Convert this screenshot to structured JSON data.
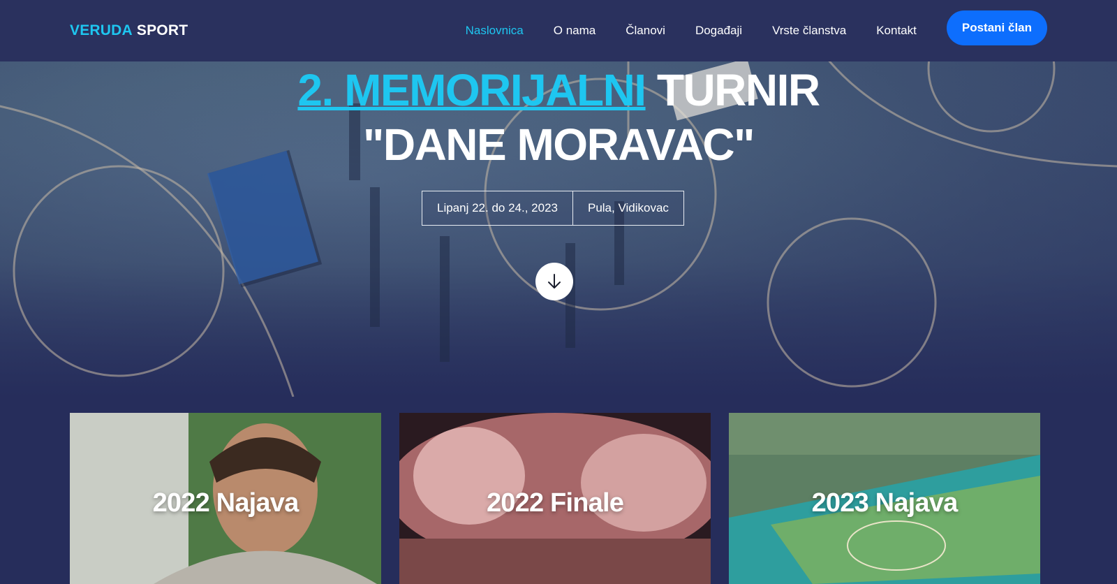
{
  "navbar": {
    "brand_part1": "VERUDA",
    "brand_part2": "SPORT",
    "links": [
      {
        "label": "Naslovnica",
        "active": true
      },
      {
        "label": "O nama"
      },
      {
        "label": "Članovi"
      },
      {
        "label": "Događaji"
      },
      {
        "label": "Vrste članstva"
      },
      {
        "label": "Kontakt"
      }
    ],
    "cta_label": "Postani član"
  },
  "hero": {
    "title_highlight": "2. MEMORIJALNI",
    "title_rest": "TURNIR",
    "title_line2": "\"DANE MORAVAC\"",
    "date": "Lipanj 22. do 24., 2023",
    "location": "Pula, Vidikovac",
    "scroll_icon": "arrow-down-icon"
  },
  "cards": [
    {
      "label": "2022 Najava"
    },
    {
      "label": "2022 Finale"
    },
    {
      "label": "2023 Najava"
    }
  ],
  "colors": {
    "accent": "#1ec6f0",
    "navbar_bg": "#2a315e",
    "page_bg": "#262d5b",
    "cta_bg": "#0d6efd"
  }
}
